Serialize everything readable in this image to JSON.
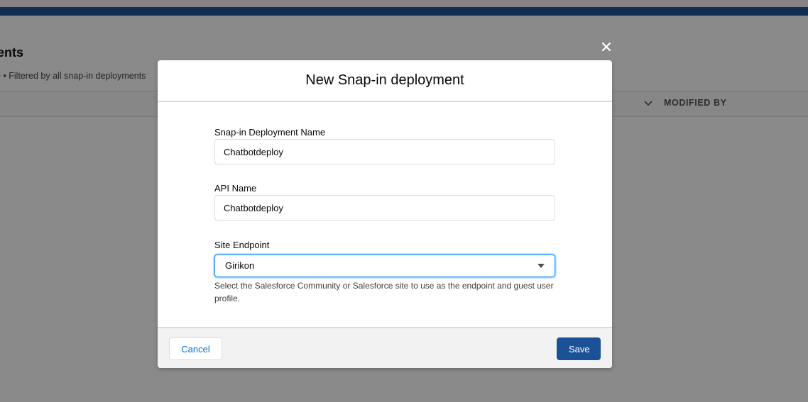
{
  "background": {
    "heading": "ments",
    "subtitle": "e • Filtered by all snap-in deployments",
    "table": {
      "columns": [
        {
          "label": "MODIFIED BY"
        }
      ]
    }
  },
  "modal": {
    "title": "New Snap-in deployment",
    "fields": {
      "deployment_name": {
        "label": "Snap-in Deployment Name",
        "value": "Chatbotdeploy"
      },
      "api_name": {
        "label": "API Name",
        "value": "Chatbotdeploy"
      },
      "site_endpoint": {
        "label": "Site Endpoint",
        "selected": "Girikon",
        "help": "Select the Salesforce Community or Salesforce site to use as the endpoint and guest user profile."
      }
    },
    "footer": {
      "cancel_label": "Cancel",
      "save_label": "Save"
    }
  },
  "colors": {
    "brand": "#1b5297",
    "link": "#0070d2",
    "focus": "#1b96ff"
  },
  "icons": {
    "close": "close-icon",
    "caret": "chevron-down-icon",
    "sort": "chevron-down-icon"
  }
}
